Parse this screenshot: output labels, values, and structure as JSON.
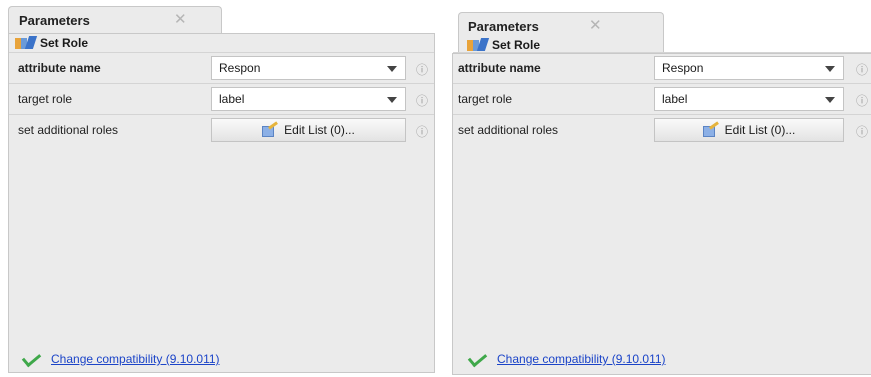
{
  "panels": [
    {
      "tab_title": "Parameters",
      "close_glyph": "✕",
      "operator_name": "Set Role",
      "operator_icon": "set-role-icon",
      "rows": [
        {
          "label": "attribute name",
          "value": "Respon"
        },
        {
          "label": "target role",
          "value": "label"
        },
        {
          "label": "set additional roles",
          "button_label": "Edit List (0)..."
        }
      ],
      "info_glyph": "ⓘ",
      "footer_link": "Change compatibility (9.10.011)"
    },
    {
      "tab_title": "Parameters",
      "close_glyph": "✕",
      "operator_name": "Set Role",
      "operator_icon": "set-role-icon",
      "rows": [
        {
          "label": "attribute name",
          "value": "Respon"
        },
        {
          "label": "target role",
          "value": "label"
        },
        {
          "label": "set additional roles",
          "button_label": "Edit List (0)..."
        }
      ],
      "info_glyph": "ⓘ",
      "footer_link": "Change compatibility (9.10.011)"
    }
  ],
  "colors": {
    "panel_bg": "#ebebeb",
    "link": "#1b44c8",
    "check": "#3fa84a"
  }
}
